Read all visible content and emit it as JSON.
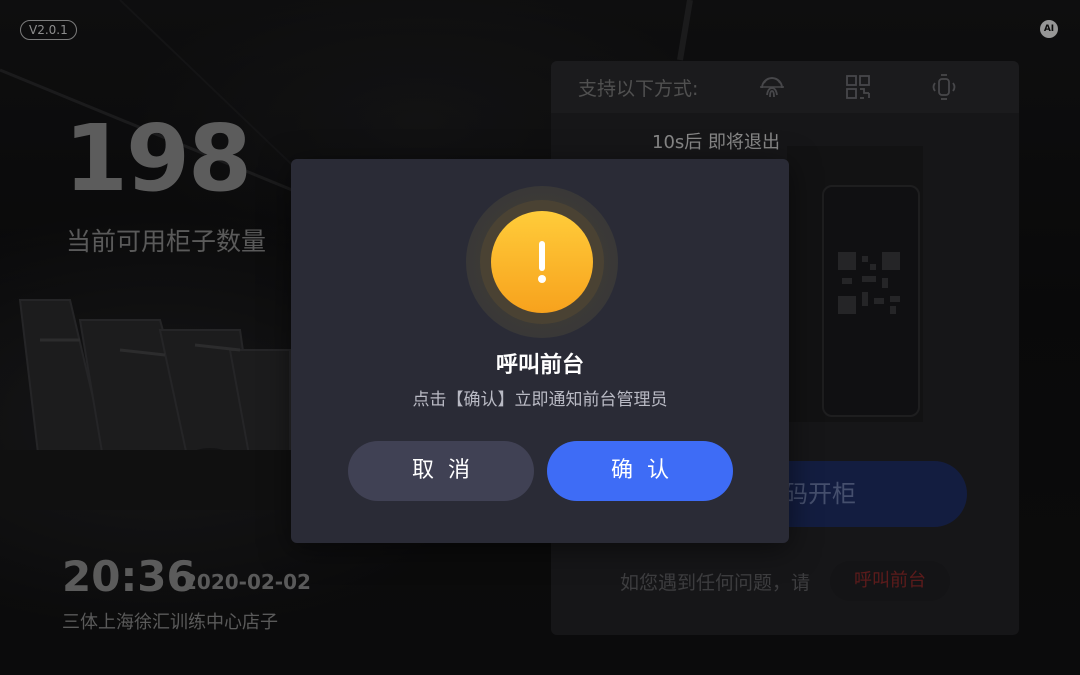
{
  "app": {
    "version": "V2.0.1",
    "ai_badge": "AI"
  },
  "left": {
    "available_count": "198",
    "available_label": "当前可用柜子数量",
    "time": "20:36",
    "date": "2020-02-02",
    "store_name": "三体上海徐汇训练中心店子"
  },
  "panel": {
    "methods_label": "支持以下方式:",
    "method_icons": [
      "fingerprint-icon",
      "qr-code-icon",
      "wristband-icon"
    ],
    "countdown": "10s后 即将退出",
    "scan_button_label": "码开柜",
    "help_prompt": "如您遇到任何问题，请",
    "help_button_label": "呼叫前台"
  },
  "modal": {
    "icon": "warning-icon",
    "title": "呼叫前台",
    "message": "点击【确认】立即通知前台管理员",
    "cancel_label": "取消",
    "confirm_label": "确认"
  },
  "colors": {
    "accent": "#3e6cf6",
    "warning": "#fbb529",
    "modal_bg": "#2a2b36",
    "danger_text": "#8e2a2a"
  }
}
